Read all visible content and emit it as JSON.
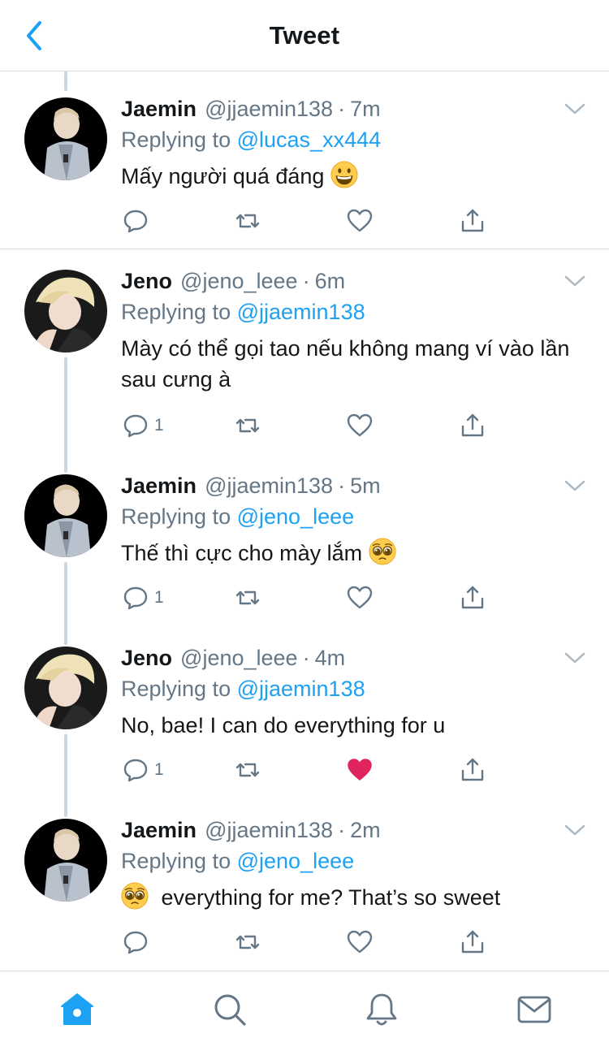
{
  "header": {
    "title": "Tweet"
  },
  "colors": {
    "link": "#1da1f2",
    "gray": "#657786",
    "like_active": "#e0245e",
    "tab_active": "#1da1f2"
  },
  "tweets": [
    {
      "name": "Jaemin",
      "handle": "@jjaemin138",
      "dot": "·",
      "time": "7m",
      "replying_label": "Replying to",
      "replying_to": "@lucas_xx444",
      "text": "Mấy người quá đáng",
      "emoji": "grinning-face",
      "reply_count": "",
      "liked": false
    },
    {
      "name": "Jeno",
      "handle": "@jeno_leee",
      "dot": "·",
      "time": "6m",
      "replying_label": "Replying to",
      "replying_to": "@jjaemin138",
      "text": "Mày có thể gọi tao nếu không mang ví vào lần sau cưng à",
      "emoji": "",
      "reply_count": "1",
      "liked": false
    },
    {
      "name": "Jaemin",
      "handle": "@jjaemin138",
      "dot": "·",
      "time": "5m",
      "replying_label": "Replying to",
      "replying_to": "@jeno_leee",
      "text": "Thế thì cực cho mày lắm",
      "emoji": "pleading-face",
      "reply_count": "1",
      "liked": false
    },
    {
      "name": "Jeno",
      "handle": "@jeno_leee",
      "dot": "·",
      "time": "4m",
      "replying_label": "Replying to",
      "replying_to": "@jjaemin138",
      "text": "No, bae! I can do everything for u",
      "emoji": "",
      "reply_count": "1",
      "liked": true
    },
    {
      "name": "Jaemin",
      "handle": "@jjaemin138",
      "dot": "·",
      "time": "2m",
      "replying_label": "Replying to",
      "replying_to": "@jeno_leee",
      "text": "everything for me? That’s so sweet",
      "emoji_lead": "pleading-face",
      "reply_count": "",
      "liked": false
    }
  ],
  "tabbar": {
    "items": [
      "home-icon",
      "search-icon",
      "notifications-icon",
      "messages-icon"
    ],
    "active": "home-icon"
  }
}
